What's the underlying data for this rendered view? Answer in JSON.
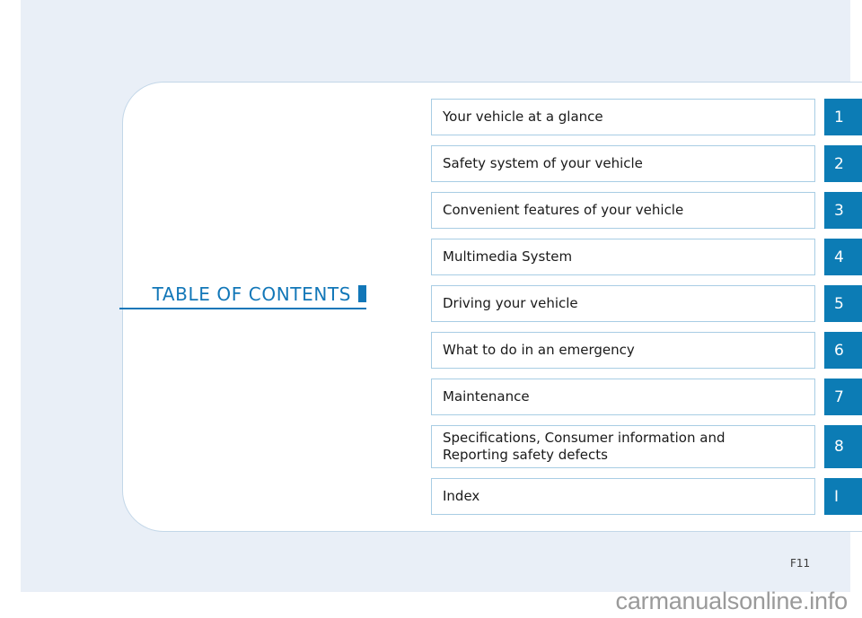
{
  "page": {
    "page_number": "F11",
    "watermark": "carmanualsonline.info",
    "accent_color": "#0c7cb5",
    "title_color": "#1277b8",
    "row_border_color": "#a8cde4",
    "sheet_background": "#e9eff7"
  },
  "toc": {
    "title": "TABLE OF CONTENTS",
    "rows": [
      {
        "label": "Your vehicle at a glance",
        "label_line2": "",
        "tab": "1"
      },
      {
        "label": "Safety system of your vehicle",
        "label_line2": "",
        "tab": "2"
      },
      {
        "label": "Convenient features of your vehicle",
        "label_line2": "",
        "tab": "3"
      },
      {
        "label": "Multimedia System",
        "label_line2": "",
        "tab": "4"
      },
      {
        "label": "Driving your vehicle",
        "label_line2": "",
        "tab": "5"
      },
      {
        "label": "What to do in an emergency",
        "label_line2": "",
        "tab": "6"
      },
      {
        "label": "Maintenance",
        "label_line2": "",
        "tab": "7"
      },
      {
        "label": "Specifications, Consumer information and",
        "label_line2": "Reporting safety defects",
        "tab": "8"
      },
      {
        "label": "Index",
        "label_line2": "",
        "tab": "I"
      }
    ]
  }
}
